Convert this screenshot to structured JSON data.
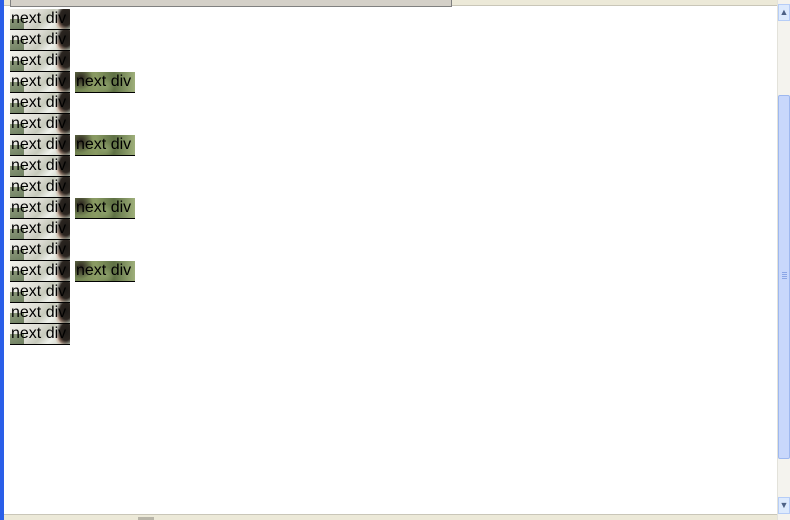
{
  "tile_label": "next div",
  "rows": [
    {
      "right": false
    },
    {
      "right": false
    },
    {
      "right": false
    },
    {
      "right": true
    },
    {
      "right": false
    },
    {
      "right": false
    },
    {
      "right": true
    },
    {
      "right": false
    },
    {
      "right": false
    },
    {
      "right": true
    },
    {
      "right": false
    },
    {
      "right": false
    },
    {
      "right": true
    },
    {
      "right": false
    },
    {
      "right": false
    },
    {
      "right": false
    }
  ],
  "scrollbar": {
    "up_arrow": "▲",
    "down_arrow": "▼"
  },
  "colors": {
    "frame_blue": "#2a5ee8",
    "scroll_thumb": "#c8d7fb",
    "chrome": "#ece9d8"
  }
}
